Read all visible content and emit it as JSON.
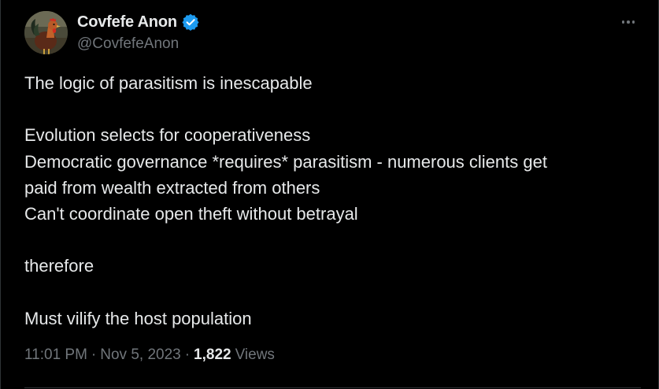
{
  "author": {
    "display_name": "Covfefe Anon",
    "handle": "@CovfefeAnon",
    "verified": true,
    "avatar_icon": "rooster-avatar"
  },
  "tweet": {
    "lines": [
      "The logic of parasitism is inescapable",
      "",
      "Evolution selects for cooperativeness",
      "Democratic governance *requires* parasitism - numerous clients get",
      "paid from wealth extracted from others",
      "Can't coordinate open theft without betrayal",
      "",
      "therefore",
      "",
      "Must vilify the host population"
    ]
  },
  "meta": {
    "time": "11:01 PM",
    "separator": "·",
    "date": "Nov 5, 2023",
    "views_count": "1,822",
    "views_label": "Views"
  },
  "colors": {
    "background": "#000000",
    "text": "#e7e9ea",
    "muted": "#71767b",
    "verified_blue": "#1d9bf0",
    "border": "#2f3336"
  }
}
